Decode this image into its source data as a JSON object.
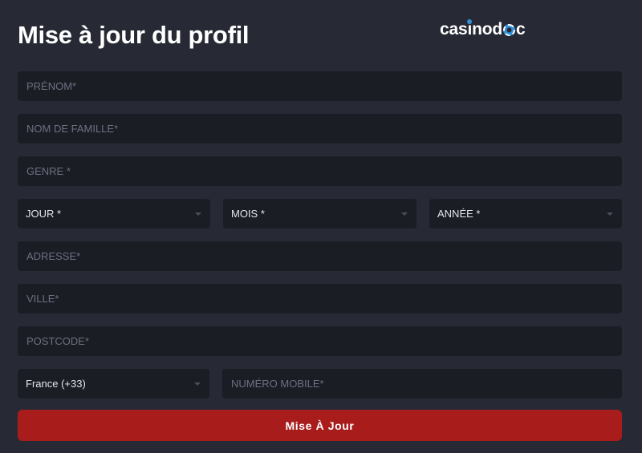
{
  "header": {
    "title": "Mise à jour du profil",
    "logo": {
      "part1": "cas",
      "part2": "i",
      "part3": "nod",
      "part4": "c"
    }
  },
  "form": {
    "first_name": {
      "placeholder": "PRÉNOM*"
    },
    "last_name": {
      "placeholder": "NOM DE FAMILLE*"
    },
    "gender": {
      "placeholder": "GENRE *"
    },
    "birth_day": {
      "value": "JOUR *"
    },
    "birth_month": {
      "value": "MOIS *"
    },
    "birth_year": {
      "value": "ANNÉE *"
    },
    "address": {
      "placeholder": "ADRESSE*"
    },
    "city": {
      "placeholder": "VILLE*"
    },
    "postcode": {
      "placeholder": "POSTCODE*"
    },
    "country_code": {
      "value": "France (+33)"
    },
    "mobile": {
      "placeholder": "NUMÉRO MOBILE*"
    },
    "submit_label": "Mise À Jour"
  },
  "colors": {
    "background": "#272a35",
    "field": "#1b1d25",
    "button": "#a81c1c",
    "logo_accent": "#2f8fd8"
  }
}
